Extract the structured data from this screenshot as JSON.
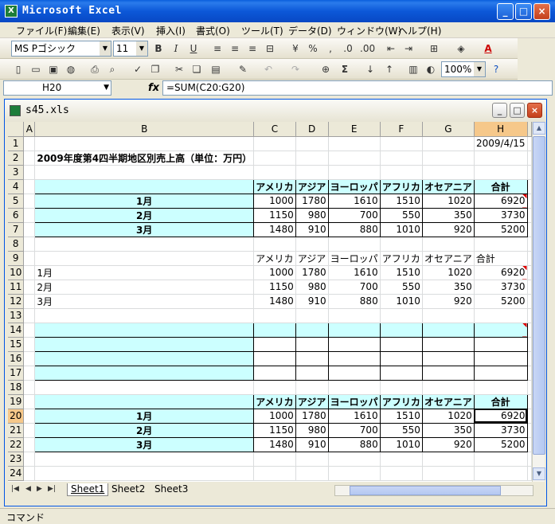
{
  "window": {
    "title": "Microsoft Excel"
  },
  "menu": [
    "ファイル(F)",
    "編集(E)",
    "表示(V)",
    "挿入(I)",
    "書式(O)",
    "ツール(T)",
    "データ(D)",
    "ウィンドウ(W)",
    "ヘルプ(H)"
  ],
  "toolbar": {
    "font_name": "MS Pゴシック",
    "font_size": "11",
    "zoom": "100%"
  },
  "formula_bar": {
    "name_box": "H20",
    "fx": "fx",
    "formula": "=SUM(C20:G20)"
  },
  "workbook": {
    "name": "s45.xls"
  },
  "columns": [
    "A",
    "B",
    "C",
    "D",
    "E",
    "F",
    "G",
    "H"
  ],
  "cells": {
    "H1": "2009/4/15",
    "B2": "2009年度第4四半期地区別売上高（単位：万円）",
    "C4": "アメリカ",
    "D4": "アジア",
    "E4": "ヨーロッパ",
    "F4": "アフリカ",
    "G4": "オセアニア",
    "H4": "合計",
    "B5": "1月",
    "C5": "1000",
    "D5": "1780",
    "E5": "1610",
    "F5": "1510",
    "G5": "1020",
    "H5": "6920",
    "B6": "2月",
    "C6": "1150",
    "D6": "980",
    "E6": "700",
    "F6": "550",
    "G6": "350",
    "H6": "3730",
    "B7": "3月",
    "C7": "1480",
    "D7": "910",
    "E7": "880",
    "F7": "1010",
    "G7": "920",
    "H7": "5200",
    "C9": "アメリカ",
    "D9": "アジア",
    "E9": "ヨーロッパ",
    "F9": "アフリカ",
    "G9": "オセアニア",
    "H9": "合計",
    "B10": "1月",
    "C10": "1000",
    "D10": "1780",
    "E10": "1610",
    "F10": "1510",
    "G10": "1020",
    "H10": "6920",
    "B11": "2月",
    "C11": "1150",
    "D11": "980",
    "E11": "700",
    "F11": "550",
    "G11": "350",
    "H11": "3730",
    "B12": "3月",
    "C12": "1480",
    "D12": "910",
    "E12": "880",
    "F12": "1010",
    "G12": "920",
    "H12": "5200",
    "C19": "アメリカ",
    "D19": "アジア",
    "E19": "ヨーロッパ",
    "F19": "アフリカ",
    "G19": "オセアニア",
    "H19": "合計",
    "B20": "1月",
    "C20": "1000",
    "D20": "1780",
    "E20": "1610",
    "F20": "1510",
    "G20": "1020",
    "H20": "6920",
    "B21": "2月",
    "C21": "1150",
    "D21": "980",
    "E21": "700",
    "F21": "550",
    "G21": "350",
    "H21": "3730",
    "B22": "3月",
    "C22": "1480",
    "D22": "910",
    "E22": "880",
    "F22": "1010",
    "G22": "920",
    "H22": "5200"
  },
  "sheets": [
    "Sheet1",
    "Sheet2",
    "Sheet3"
  ],
  "status": "コマンド",
  "colors": {
    "cyan_fill": "#ccffff",
    "selection_header": "#f6c88a",
    "title_blue": "#0a5fdc"
  }
}
